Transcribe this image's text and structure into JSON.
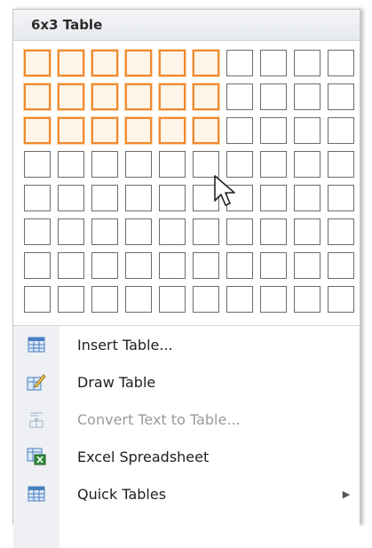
{
  "header": {
    "title": "6x3 Table"
  },
  "grid": {
    "columns": 10,
    "rows": 8,
    "selected_columns": 6,
    "selected_rows": 3
  },
  "menu": {
    "items": [
      {
        "id": "insert-table",
        "label": "Insert Table...",
        "icon": "table-grid-icon",
        "disabled": false
      },
      {
        "id": "draw-table",
        "label": "Draw Table",
        "icon": "pencil-table-icon",
        "disabled": false
      },
      {
        "id": "convert-text",
        "label": "Convert Text to Table...",
        "icon": "convert-text-icon",
        "disabled": true
      },
      {
        "id": "excel-spreadsheet",
        "label": "Excel Spreadsheet",
        "icon": "excel-sheet-icon",
        "disabled": false
      },
      {
        "id": "quick-tables",
        "label": "Quick Tables",
        "icon": "quick-tables-icon",
        "disabled": false,
        "submenu": true
      }
    ]
  },
  "colors": {
    "selection": "#f08a30",
    "icon_blue": "#4a7fc1",
    "excel_green": "#2e8b3a"
  }
}
